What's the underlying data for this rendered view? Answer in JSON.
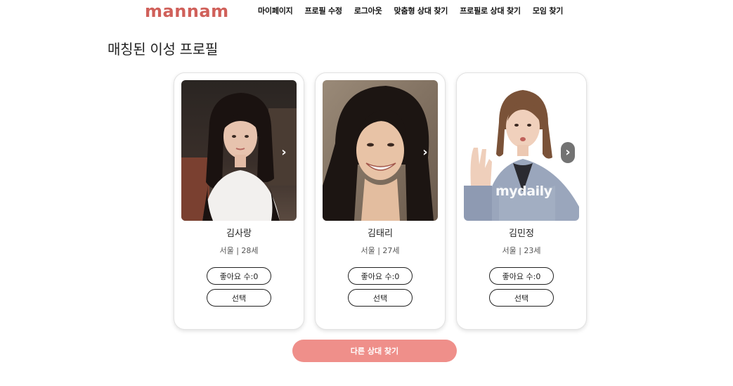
{
  "header": {
    "logo": "mannam",
    "nav": [
      {
        "label": "마이페이지"
      },
      {
        "label": "프로필 수정"
      },
      {
        "label": "로그아웃"
      },
      {
        "label": "맞춤형 상대 찾기"
      },
      {
        "label": "프로필로 상대 찾기"
      },
      {
        "label": "모임 찾기"
      }
    ]
  },
  "page": {
    "title": "매칭된 이성 프로필"
  },
  "cards": [
    {
      "name": "김사랑",
      "meta": "서울 | 28세",
      "like_label": "좋아요 수:0",
      "select_label": "선택",
      "next_icon": "chevron-right-icon"
    },
    {
      "name": "김태리",
      "meta": "서울 | 27세",
      "like_label": "좋아요 수:0",
      "select_label": "선택",
      "next_icon": "chevron-right-icon"
    },
    {
      "name": "김민정",
      "meta": "서울 | 23세",
      "like_label": "좋아요 수:0",
      "select_label": "선택",
      "next_icon": "chevron-right-icon",
      "photo_mark": "mydaily"
    }
  ],
  "actions": {
    "find_other": "다른 상대 찾기"
  },
  "colors": {
    "brand": "#d0605a",
    "primary_button": "#ef8f8a",
    "card_border": "#e2e2e2"
  }
}
